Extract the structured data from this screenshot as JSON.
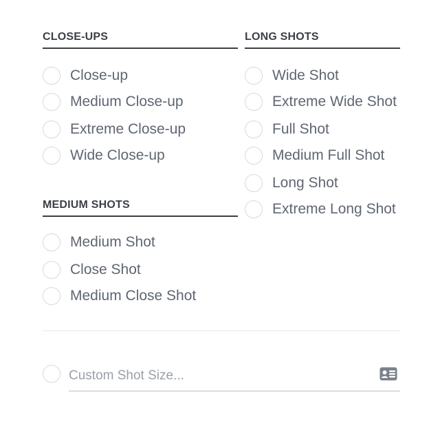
{
  "sections": [
    {
      "key": "close_ups",
      "header": "CLOSE-UPS",
      "options": [
        "Close-up",
        "Medium Close-up",
        "Extreme Close-up",
        "Wide Close-up"
      ]
    },
    {
      "key": "medium_shots",
      "header": "MEDIUM SHOTS",
      "options": [
        "Medium Shot",
        "Close Shot",
        "Medium Close Shot"
      ]
    },
    {
      "key": "long_shots",
      "header": "LONG SHOTS",
      "options": [
        "Wide Shot",
        "Extreme Wide Shot",
        "Full Shot",
        "Medium Full Shot",
        "Long Shot",
        "Extreme Long Shot"
      ]
    }
  ],
  "custom": {
    "placeholder": "Custom Shot Size...",
    "value": "",
    "icon": "id-card-icon"
  },
  "colors": {
    "text": "#5f6672",
    "header": "#3b3f46",
    "radio_border": "#d6d9de",
    "divider": "#e6e8eb",
    "placeholder": "#9aa0a8",
    "icon": "#7b818a"
  }
}
